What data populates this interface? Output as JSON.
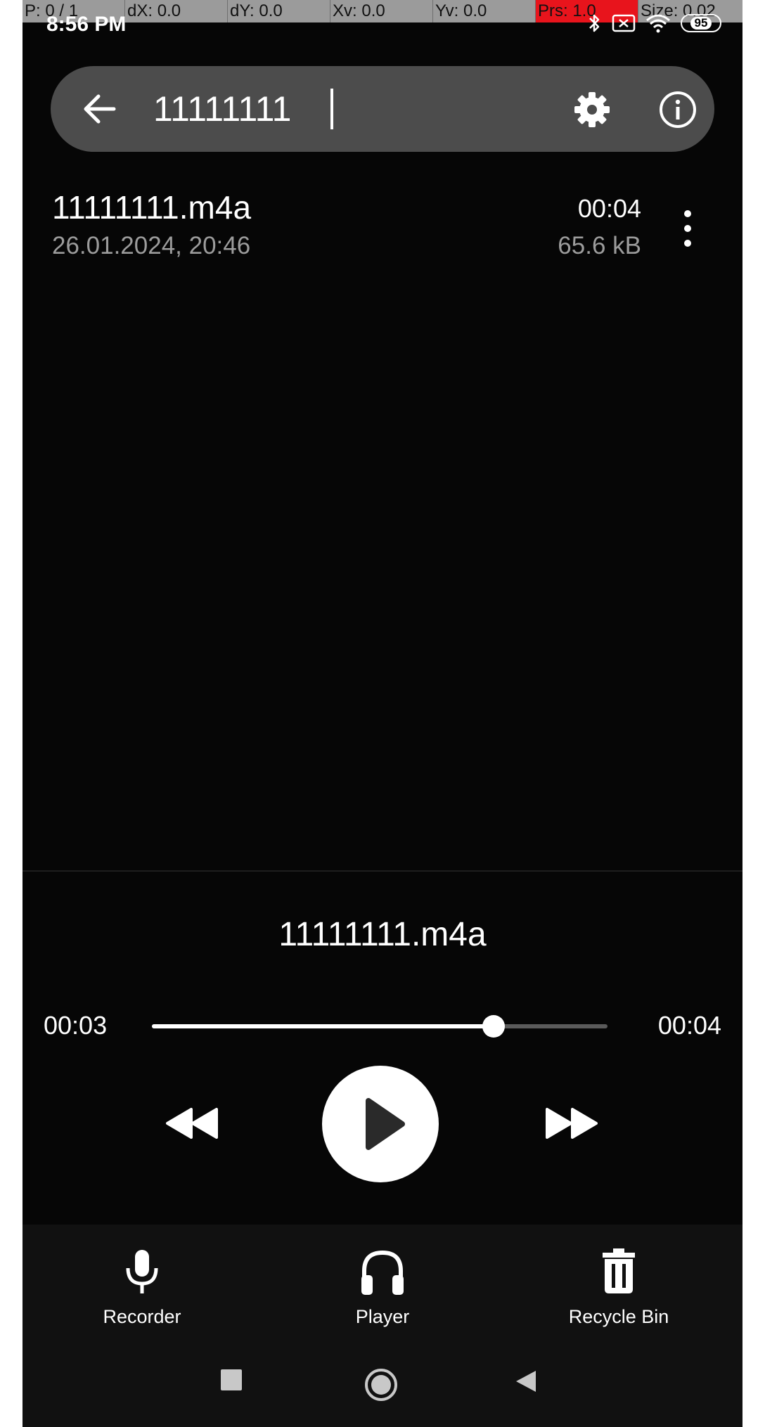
{
  "debug_overlay": {
    "cells": [
      "P: 0 / 1",
      "dX: 0.0",
      "dY: 0.0",
      "Xv: 0.0",
      "Yv: 0.0",
      "Prs: 1.0",
      "Size: 0.02"
    ]
  },
  "status_bar": {
    "time": "8:56 PM",
    "battery": "95",
    "icons": [
      "bluetooth-icon",
      "screen-cast-icon",
      "wifi-icon",
      "battery-icon"
    ]
  },
  "search": {
    "value": "11111111",
    "icons": [
      "back-arrow-icon",
      "gear-icon",
      "info-icon"
    ]
  },
  "recordings": [
    {
      "name": "11111111.m4a",
      "date": "26.01.2024, 20:46",
      "duration": "00:04",
      "size": "65.6 kB"
    }
  ],
  "player": {
    "title": "11111111.m4a",
    "current_time": "00:03",
    "total_time": "00:04",
    "progress": 0.75,
    "icons": [
      "rewind-icon",
      "play-icon",
      "fast-forward-icon"
    ]
  },
  "bottom_nav": {
    "items": [
      {
        "label": "Recorder",
        "icon": "microphone-icon"
      },
      {
        "label": "Player",
        "icon": "headphones-icon"
      },
      {
        "label": "Recycle Bin",
        "icon": "trash-icon"
      }
    ]
  },
  "system_nav": [
    "recents-square-icon",
    "home-circle-icon",
    "back-triangle-icon"
  ],
  "colors": {
    "background": "#060606",
    "search_bar": "#4c4c4c",
    "secondary_text": "#9c9c9c",
    "debug_hot": "#e8141c"
  }
}
